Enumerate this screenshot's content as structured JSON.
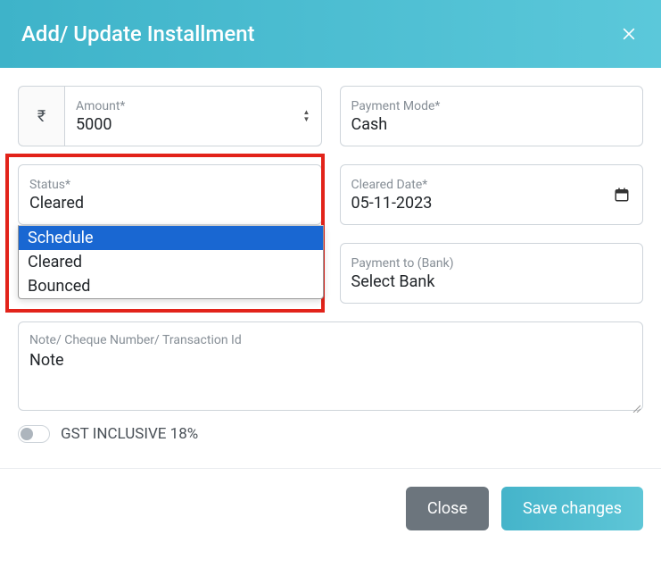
{
  "header": {
    "title": "Add/ Update Installment"
  },
  "amount": {
    "label": "Amount*",
    "currency": "₹",
    "value": "5000"
  },
  "payment_mode": {
    "label": "Payment Mode*",
    "value": "Cash"
  },
  "status": {
    "label": "Status*",
    "value": "Cleared",
    "options": [
      "Schedule",
      "Cleared",
      "Bounced"
    ]
  },
  "cleared_date": {
    "label": "Cleared Date*",
    "value": "05-11-2023"
  },
  "payment_to": {
    "label": "Payment to (Bank)",
    "value": "Select Bank"
  },
  "note": {
    "label": "Note/ Cheque Number/ Transaction Id",
    "value": "Note"
  },
  "gst": {
    "label": "GST INCLUSIVE 18%"
  },
  "footer": {
    "close": "Close",
    "save": "Save changes"
  }
}
